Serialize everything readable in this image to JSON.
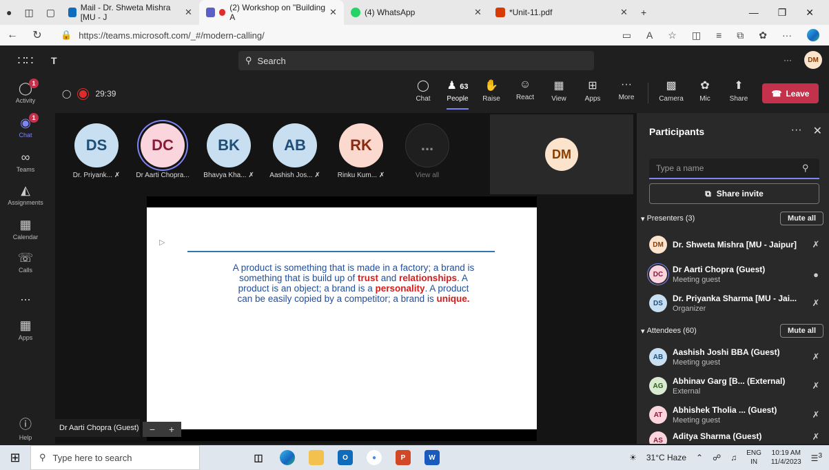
{
  "browser": {
    "tabs": [
      {
        "label": "Mail - Dr. Shweta Mishra [MU - J",
        "color": "#0f6cbd"
      },
      {
        "label": "(2) Workshop on \"Building A",
        "color": "#5b5fc7"
      },
      {
        "label": "(4) WhatsApp",
        "color": "#25d366"
      },
      {
        "label": "*Unit-11.pdf",
        "color": "#d83b01"
      }
    ],
    "url": "https://teams.microsoft.com/_#/modern-calling/"
  },
  "teams": {
    "search_label": "Search",
    "user_initials": "DM"
  },
  "rail": [
    {
      "label": "Activity",
      "icon": "bell-icon",
      "badge": "1"
    },
    {
      "label": "Chat",
      "icon": "chat-icon",
      "badge": "1"
    },
    {
      "label": "Teams",
      "icon": "teams-icon"
    },
    {
      "label": "Assignments",
      "icon": "assignments-icon"
    },
    {
      "label": "Calendar",
      "icon": "calendar-icon"
    },
    {
      "label": "Calls",
      "icon": "phone-icon"
    },
    {
      "label": "...",
      "icon": "more-icon"
    },
    {
      "label": "Apps",
      "icon": "apps-icon"
    },
    {
      "label": "Help",
      "icon": "help-icon"
    }
  ],
  "meeting": {
    "timer": "29:39",
    "people_count": "63",
    "toolbar": {
      "chat": "Chat",
      "people": "People",
      "raise": "Raise",
      "react": "React",
      "view": "View",
      "apps": "Apps",
      "more": "More",
      "camera": "Camera",
      "mic": "Mic",
      "share": "Share",
      "leave": "Leave"
    },
    "tiles": [
      {
        "initials": "DS",
        "name": "Dr. Priyank...",
        "bg": "#c7dff0",
        "fg": "#1f4e79",
        "muted": true
      },
      {
        "initials": "DC",
        "name": "Dr Aarti Chopra...",
        "bg": "#fbd5dd",
        "fg": "#8a1c3a",
        "muted": false
      },
      {
        "initials": "BK",
        "name": "Bhavya Kha...",
        "bg": "#c7dff0",
        "fg": "#1f4e79",
        "muted": true
      },
      {
        "initials": "AB",
        "name": "Aashish Jos...",
        "bg": "#c7dff0",
        "fg": "#1f4e79",
        "muted": true
      },
      {
        "initials": "RK",
        "name": "Rinku Kum...",
        "bg": "#fcd9cf",
        "fg": "#8a2c12",
        "muted": true
      }
    ],
    "view_all": "View all",
    "more_tile": "...",
    "presenter_initials": "DM",
    "name_tag": "Dr Aarti Chopra (Guest)",
    "slide_text": {
      "p1": "A product is something that is made in a factory; a brand is something that is build up of ",
      "hl1": "trust",
      "p2": " and ",
      "hl2": "relationships",
      "p3": ". A product is an object; a brand is a ",
      "hl3": "personality",
      "p4": ". A product can be easily copied by a competitor; a brand is ",
      "hl4": "unique."
    }
  },
  "participants": {
    "title": "Participants",
    "search_placeholder": "Type a name",
    "share_invite": "Share invite",
    "presenters_label": "Presenters (3)",
    "attendees_label": "Attendees (60)",
    "mute_all": "Mute all",
    "presenters": [
      {
        "initials": "DM",
        "name": "Dr. Shweta Mishra [MU - Jaipur]",
        "role": "",
        "bg": "#fbe3cc",
        "fg": "#8a3c00",
        "mic": "muted"
      },
      {
        "initials": "DC",
        "name": "Dr Aarti Chopra (Guest)",
        "role": "Meeting guest",
        "bg": "#fbd5dd",
        "fg": "#8a1c3a",
        "mic": "on"
      },
      {
        "initials": "DS",
        "name": "Dr. Priyanka Sharma [MU - Jai...",
        "role": "Organizer",
        "bg": "#c7dff0",
        "fg": "#1f4e79",
        "mic": "muted"
      }
    ],
    "attendees": [
      {
        "initials": "AB",
        "name": "Aashish Joshi BBA (Guest)",
        "role": "Meeting guest",
        "bg": "#c7dff0",
        "fg": "#1f4e79"
      },
      {
        "initials": "AG",
        "name": "Abhinav Garg [B... (External)",
        "role": "External",
        "bg": "#d8ead0",
        "fg": "#2e5d1e"
      },
      {
        "initials": "AT",
        "name": "Abhishek Tholia ... (Guest)",
        "role": "Meeting guest",
        "bg": "#fbd5dd",
        "fg": "#8a1c3a"
      },
      {
        "initials": "AS",
        "name": "Aditya Sharma (Guest)",
        "role": "",
        "bg": "#fbd5dd",
        "fg": "#8a1c3a"
      }
    ]
  },
  "taskbar": {
    "search_placeholder": "Type here to search",
    "weather": "31°C Haze",
    "lang1": "ENG",
    "lang2": "IN",
    "time": "10:19 AM",
    "date": "11/4/2023",
    "notif_count": "3"
  }
}
